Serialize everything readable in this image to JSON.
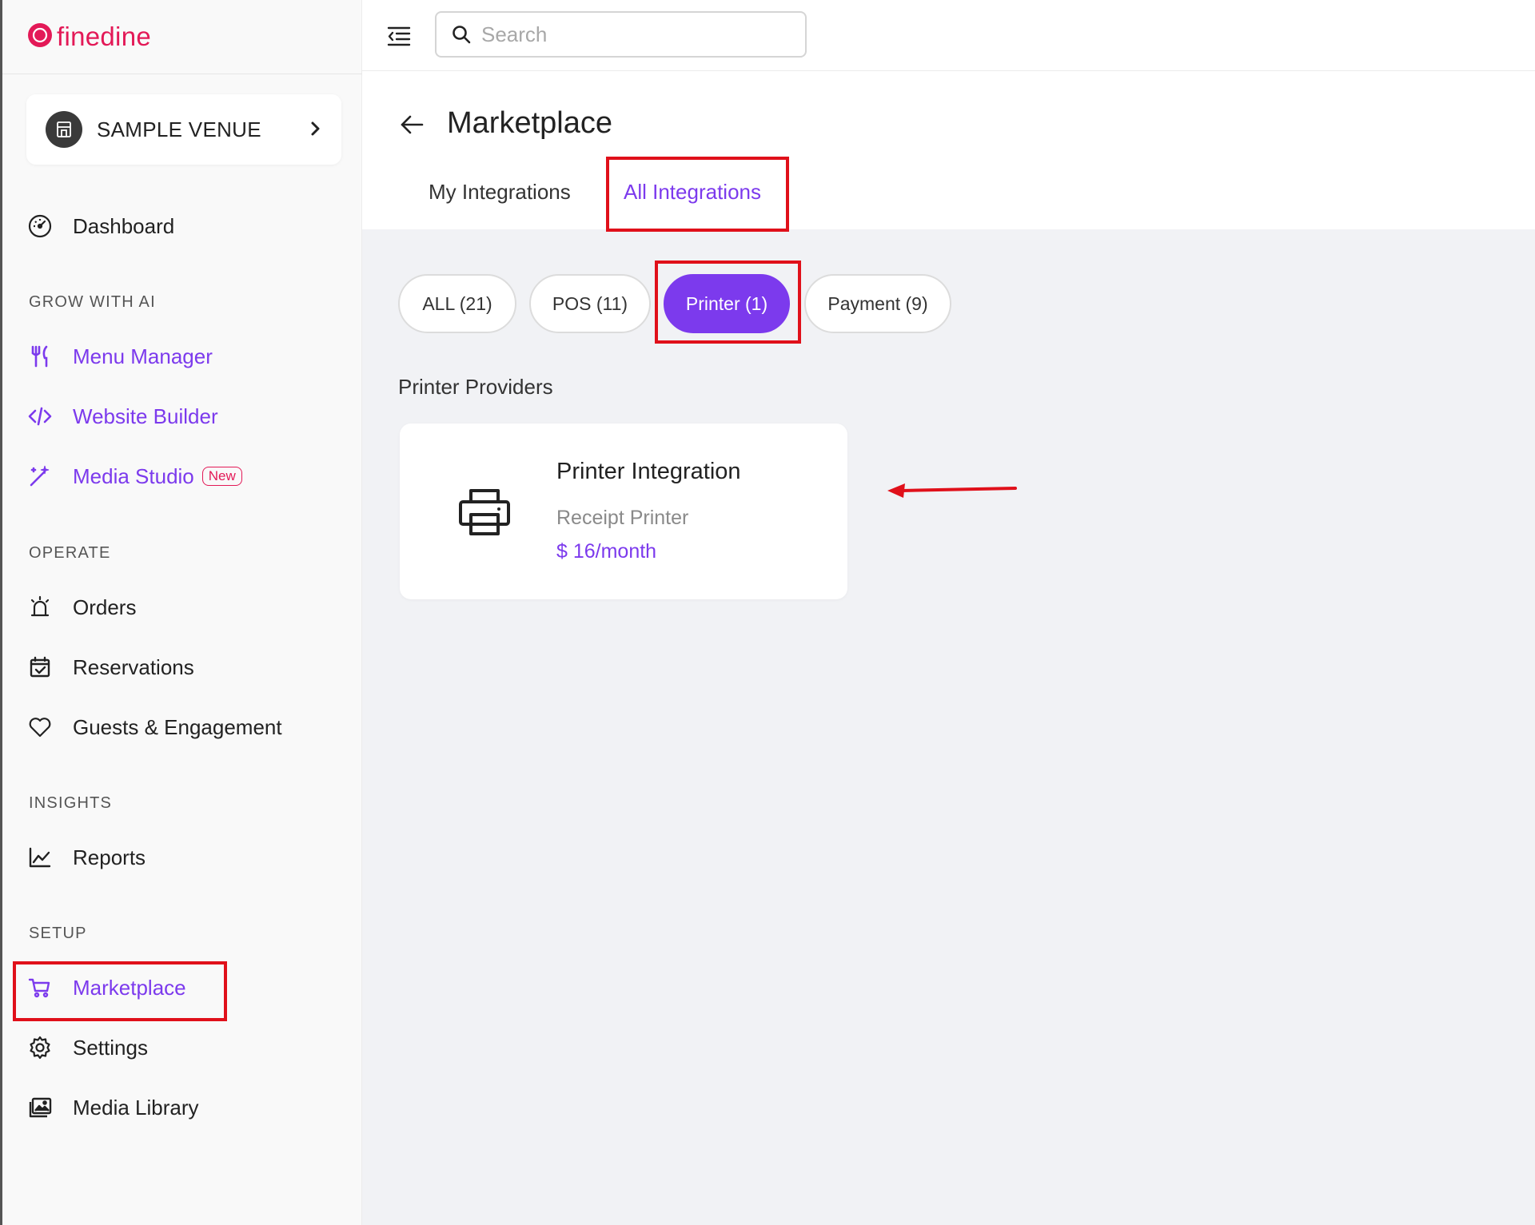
{
  "brand": {
    "logo_text": "finedine",
    "color": "#e31957"
  },
  "accent_color": "#7c3aed",
  "highlight_color": "#e0101a",
  "venue": {
    "name": "SAMPLE VENUE"
  },
  "sidebar": {
    "dashboard": "Dashboard",
    "sections": {
      "grow": "GROW WITH AI",
      "operate": "OPERATE",
      "insights": "INSIGHTS",
      "setup": "SETUP"
    },
    "items": {
      "menu_manager": "Menu Manager",
      "website_builder": "Website Builder",
      "media_studio": "Media Studio",
      "media_studio_badge": "New",
      "orders": "Orders",
      "reservations": "Reservations",
      "guests": "Guests & Engagement",
      "reports": "Reports",
      "marketplace": "Marketplace",
      "settings": "Settings",
      "media_library": "Media Library"
    }
  },
  "topbar": {
    "search_placeholder": "Search"
  },
  "page": {
    "title": "Marketplace",
    "tabs": {
      "my": "My Integrations",
      "all": "All Integrations"
    },
    "filters": {
      "all": "ALL (21)",
      "pos": "POS (11)",
      "printer": "Printer (1)",
      "payment": "Payment (9)"
    },
    "section_label": "Printer Providers",
    "card": {
      "title": "Printer Integration",
      "subtitle": "Receipt Printer",
      "price": "$ 16/month",
      "icon": "printer-icon"
    }
  }
}
